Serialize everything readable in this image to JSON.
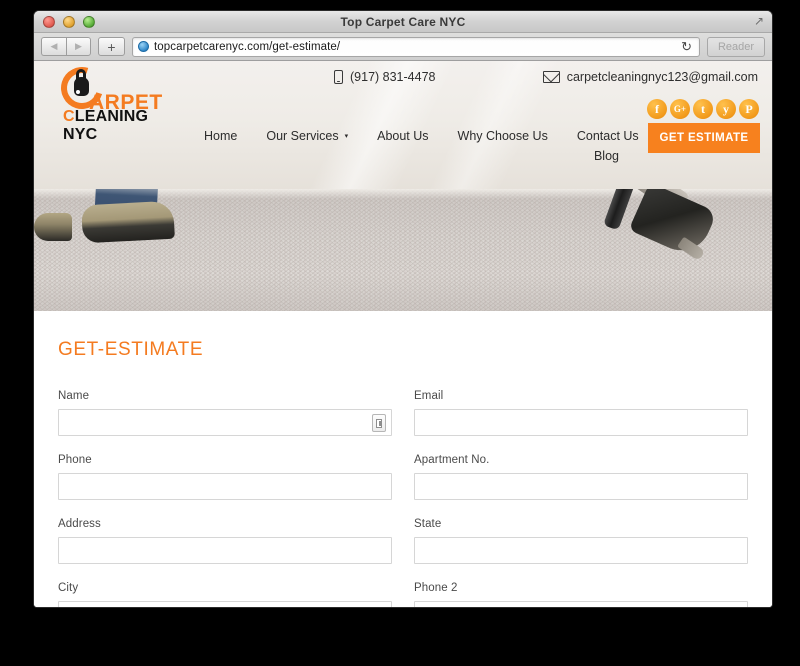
{
  "window": {
    "title": "Top Carpet Care NYC",
    "traffic_lights": [
      "close",
      "minimize",
      "zoom"
    ],
    "resize_icon": "↗",
    "back_icon": "◀",
    "forward_icon": "▶",
    "new_tab_label": "+",
    "url": "topcarpetcarenyc.com/get-estimate/",
    "reload_icon": "↻",
    "reader_label": "Reader"
  },
  "site": {
    "logo": {
      "word1": "ARPET",
      "word2_c": "C",
      "word2_rest": "LEANING NYC"
    },
    "contact": {
      "phone": "(917) 831-4478",
      "email": "carpetcleaningnyc123@gmail.com"
    },
    "social": [
      {
        "name": "facebook",
        "glyph": "f"
      },
      {
        "name": "google-plus",
        "glyph": "G+"
      },
      {
        "name": "twitter",
        "glyph": "t"
      },
      {
        "name": "yelp",
        "glyph": "y"
      },
      {
        "name": "pinterest",
        "glyph": "P"
      }
    ],
    "cta": {
      "label": "GET ESTIMATE",
      "color": "#f7811e"
    },
    "nav": [
      {
        "label": "Home",
        "has_dropdown": false
      },
      {
        "label": "Our Services",
        "has_dropdown": true
      },
      {
        "label": "About Us",
        "has_dropdown": false
      },
      {
        "label": "Why Choose Us",
        "has_dropdown": false
      },
      {
        "label": "Contact Us",
        "has_dropdown": false
      },
      {
        "label": "Blog",
        "has_dropdown": false
      }
    ],
    "caret_glyph": "▾"
  },
  "main": {
    "page_title": "GET-ESTIMATE",
    "title_color": "#f47b20",
    "fields": [
      {
        "label": "Name",
        "value": "",
        "placeholder": "",
        "has_autofill": true
      },
      {
        "label": "Email",
        "value": "",
        "placeholder": "",
        "has_autofill": false
      },
      {
        "label": "Phone",
        "value": "",
        "placeholder": "",
        "has_autofill": false
      },
      {
        "label": "Apartment No.",
        "value": "",
        "placeholder": "",
        "has_autofill": false
      },
      {
        "label": "Address",
        "value": "",
        "placeholder": "",
        "has_autofill": false
      },
      {
        "label": "State",
        "value": "",
        "placeholder": "",
        "has_autofill": false
      },
      {
        "label": "City",
        "value": "",
        "placeholder": "",
        "has_autofill": false
      },
      {
        "label": "Phone 2",
        "value": "",
        "placeholder": "",
        "has_autofill": false
      }
    ]
  }
}
